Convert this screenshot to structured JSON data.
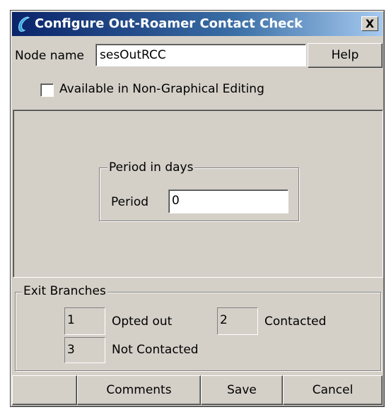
{
  "window": {
    "title": "Configure Out-Roamer Contact Check",
    "close_label": "X"
  },
  "node": {
    "label": "Node name",
    "value": "sesOutRCC",
    "help_label": "Help",
    "checkbox_label": "Available in Non-Graphical Editing",
    "checkbox_checked": false
  },
  "period": {
    "group_label": "Period in days",
    "label": "Period",
    "value": "0"
  },
  "exit_branches": {
    "group_label": "Exit Branches",
    "items": [
      {
        "number": "1",
        "label": "Opted out"
      },
      {
        "number": "2",
        "label": "Contacted"
      },
      {
        "number": "3",
        "label": "Not Contacted"
      }
    ]
  },
  "buttons": {
    "comments": "Comments",
    "save": "Save",
    "cancel": "Cancel"
  }
}
